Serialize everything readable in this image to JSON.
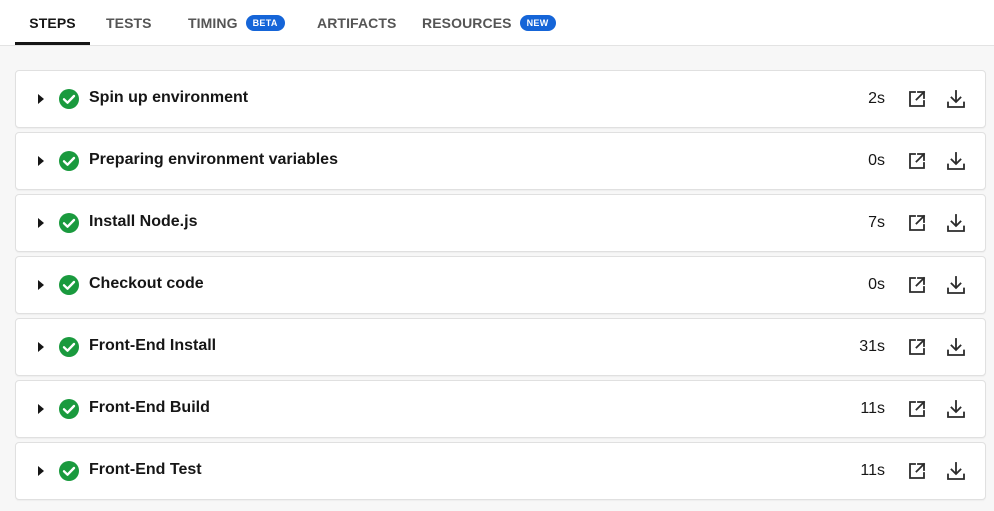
{
  "tabs": [
    {
      "label": "STEPS",
      "active": true
    },
    {
      "label": "TESTS",
      "active": false
    },
    {
      "label": "TIMING",
      "active": false,
      "badge": "BETA"
    },
    {
      "label": "ARTIFACTS",
      "active": false
    },
    {
      "label": "RESOURCES",
      "active": false,
      "badge": "NEW"
    }
  ],
  "colors": {
    "success": "#1a9a3e",
    "badge": "#1565d8",
    "text": "#161616",
    "muted": "#555555"
  },
  "steps": [
    {
      "name": "Spin up environment",
      "duration": "2s",
      "status": "success"
    },
    {
      "name": "Preparing environment variables",
      "duration": "0s",
      "status": "success"
    },
    {
      "name": "Install Node.js",
      "duration": "7s",
      "status": "success"
    },
    {
      "name": "Checkout code",
      "duration": "0s",
      "status": "success"
    },
    {
      "name": "Front-End Install",
      "duration": "31s",
      "status": "success"
    },
    {
      "name": "Front-End Build",
      "duration": "11s",
      "status": "success"
    },
    {
      "name": "Front-End Test",
      "duration": "11s",
      "status": "success"
    }
  ],
  "icons": {
    "expand": "caret-right-icon",
    "status": "check-circle-icon",
    "open": "open-in-new-icon",
    "download": "download-icon"
  }
}
